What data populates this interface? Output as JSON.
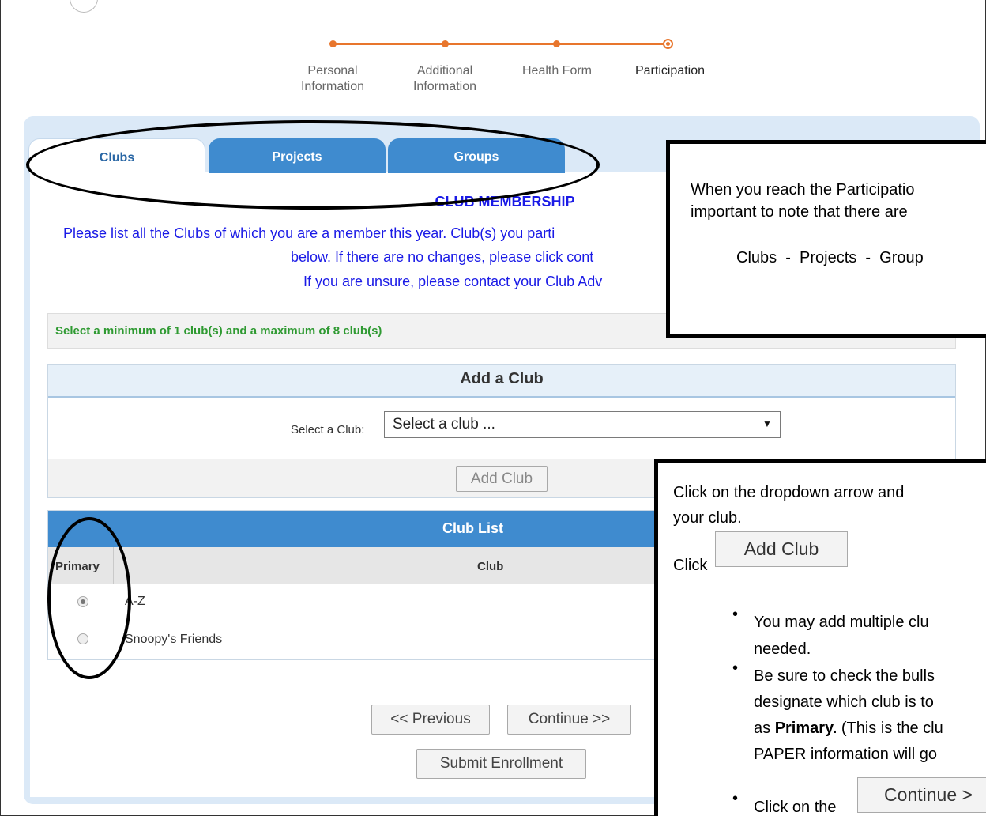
{
  "steps": {
    "personal_line1": "Personal",
    "personal_line2": "Information",
    "additional_line1": "Additional",
    "additional_line2": "Information",
    "health": "Health Form",
    "participation": "Participation"
  },
  "tabs": {
    "clubs": "Clubs",
    "projects": "Projects",
    "groups": "Groups"
  },
  "club_membership": {
    "heading": "CLUB MEMBERSHIP",
    "line1": "Please list all the Clubs of which you are a member this year. Club(s) you parti",
    "line2": "below.  If there are no changes, please click cont",
    "line3": "If you are unsure, please contact your Club Adv"
  },
  "notice": "Select a minimum of 1 club(s) and a maximum of 8 club(s)",
  "add_club": {
    "title": "Add a Club",
    "select_label": "Select a Club:",
    "select_value": "Select a club ...",
    "button": "Add Club"
  },
  "club_list": {
    "title": "Club List",
    "col_primary": "Primary",
    "col_club": "Club",
    "rows": [
      {
        "name": "A-Z",
        "primary": true
      },
      {
        "name": "Snoopy's Friends",
        "primary": false
      }
    ]
  },
  "nav": {
    "previous": "<< Previous",
    "continue": "Continue >>",
    "submit": "Submit Enrollment"
  },
  "callout_top": {
    "line1": "When you reach the Participatio",
    "line2": "important to note that there are",
    "line3": "Clubs  -  Projects  -  Group"
  },
  "callout_bottom": {
    "line1": "Click on the dropdown arrow and",
    "line2": "your club.",
    "click": "Click",
    "add_club_btn": "Add Club",
    "bullet1_a": "You may add multiple clu",
    "bullet1_b": "needed.",
    "bullet2_a": "Be sure to check the bulls",
    "bullet2_b": "designate which club is to",
    "bullet2_c_bold": "Primary.",
    "bullet2_c_pre": "as ",
    "bullet2_c_post": " (This is the clu",
    "bullet2_d": "PAPER information will go",
    "bullet3": "Click on the",
    "continue_btn": "Continue >"
  },
  "colors": {
    "accent_orange": "#e8762d",
    "tab_blue": "#3f8bcf",
    "panel_bg": "#dbe9f7",
    "link_blue": "#1a1ae6",
    "notice_green": "#2f9a32"
  }
}
